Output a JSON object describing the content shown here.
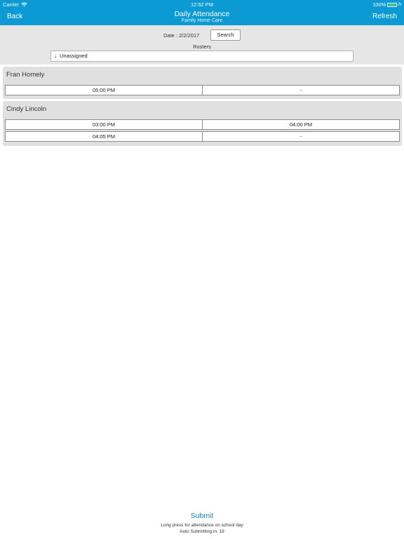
{
  "status_bar": {
    "carrier": "Carrier",
    "time": "12:52 PM",
    "battery": "100%"
  },
  "nav": {
    "back": "Back",
    "title": "Daily Attendance",
    "subtitle": "Family Home Care",
    "refresh": "Refresh"
  },
  "filters": {
    "date_label": "Date : 2/2/2017",
    "search": "Search",
    "rosters_label": "Rosters",
    "roster_arrow": "↓",
    "roster_value": "Unassigned"
  },
  "children": [
    {
      "name": "Fran Homely",
      "rows": [
        [
          "05:00 PM",
          "--"
        ]
      ]
    },
    {
      "name": "Cindy Lincoln",
      "rows": [
        [
          "03:00 PM",
          "04:00 PM"
        ],
        [
          "04:05 PM",
          "--"
        ]
      ]
    }
  ],
  "footer": {
    "submit": "Submit",
    "hint": "Long press for attendance on school day",
    "auto_submit": "Auto Submitting in: 19"
  },
  "colors": {
    "nav_bg": "#0b9ad3",
    "submit": "#1a7fc6"
  }
}
